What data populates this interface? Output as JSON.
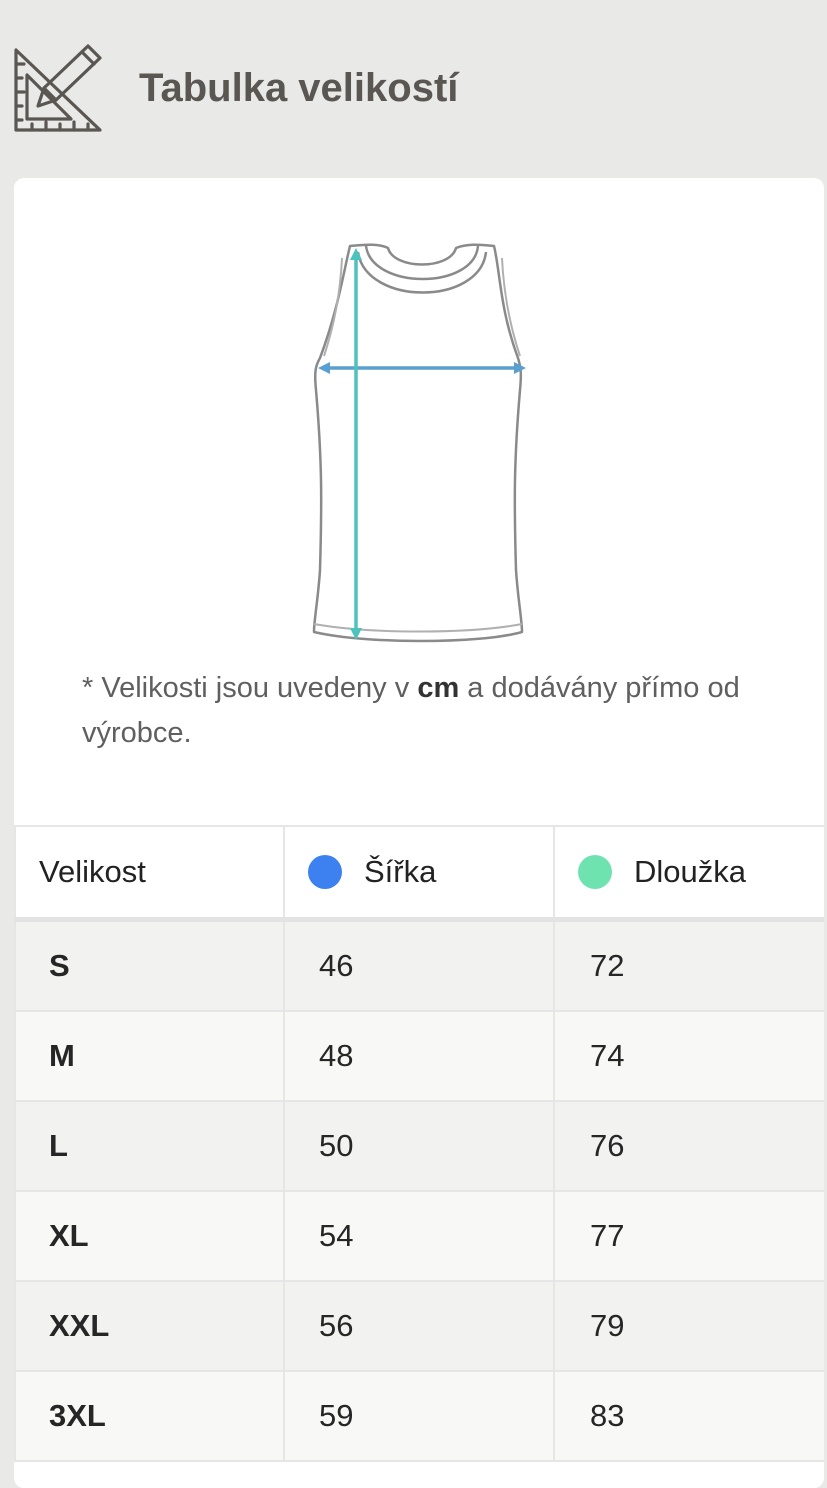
{
  "header": {
    "title": "Tabulka velikostí",
    "icon": "ruler-pencil-icon"
  },
  "garment": {
    "icon": "tank-top-measurement-diagram",
    "width_arrow_color": "#5b9fd0",
    "length_arrow_color": "#4ec3bd"
  },
  "note": {
    "prefix": "* Velikosti jsou uvedeny v ",
    "unit": "cm",
    "suffix": " a dodávány přímo od výrobce."
  },
  "table": {
    "headers": {
      "size": "Velikost",
      "width": "Šířka",
      "length": "Dloužka"
    },
    "colors": {
      "width": "#3d80f0",
      "length": "#6ee3b0"
    },
    "rows": [
      {
        "size": "S",
        "width": "46",
        "length": "72"
      },
      {
        "size": "M",
        "width": "48",
        "length": "74"
      },
      {
        "size": "L",
        "width": "50",
        "length": "76"
      },
      {
        "size": "XL",
        "width": "54",
        "length": "77"
      },
      {
        "size": "XXL",
        "width": "56",
        "length": "79"
      },
      {
        "size": "3XL",
        "width": "59",
        "length": "83"
      }
    ]
  }
}
